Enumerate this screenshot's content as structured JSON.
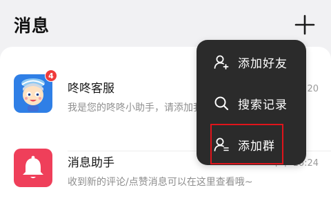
{
  "header": {
    "title": "消息",
    "add_icon": "plus-icon"
  },
  "conversations": [
    {
      "name": "咚咚客服",
      "preview": "我是您的咚咚小助手，请添加我",
      "time": "下午 16:20",
      "badge": "4",
      "avatar": "customer-service-mascot"
    },
    {
      "name": "消息助手",
      "preview": "收到新的评论/点赞消息可以在这里查看哦~",
      "time": "下午 16:24",
      "avatar": "bell-icon"
    }
  ],
  "popup_menu": {
    "items": [
      {
        "label": "添加好友",
        "icon": "add-friend-icon"
      },
      {
        "label": "搜索记录",
        "icon": "search-icon"
      },
      {
        "label": "添加群",
        "icon": "add-group-icon"
      }
    ],
    "highlighted_index": 2
  },
  "colors": {
    "background": "#f1f1f3",
    "popup": "#2b2b2b",
    "highlight": "#e1141b",
    "badge": "#ef3b3b",
    "avatar_cs": "#2f7fe6",
    "avatar_bell": "#ef3f5a"
  }
}
